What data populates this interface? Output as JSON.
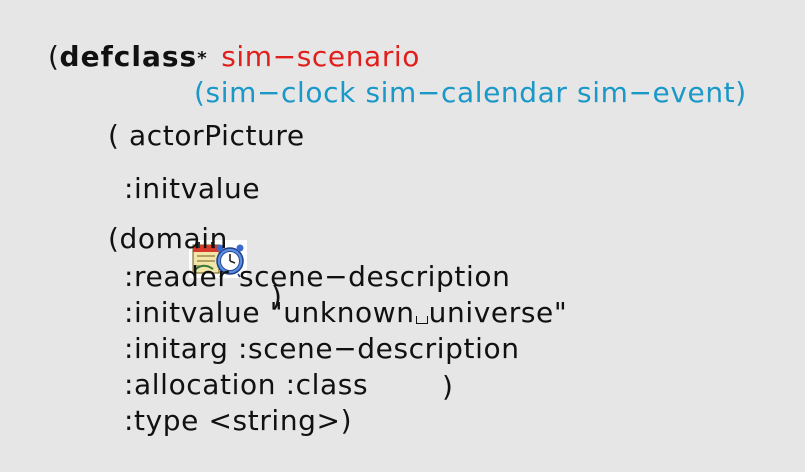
{
  "code": {
    "line1": {
      "open": "(",
      "keyword": "defclass",
      "star": "*",
      "name": "sim−scenario"
    },
    "line2": {
      "supers": "(sim−clock sim−calendar sim−event)"
    },
    "line3": {
      "text": "( actorPicture"
    },
    "line4": {
      "key": ":initvalue",
      "close": ")",
      "icon": "calendar-clock-icon"
    },
    "line5": {
      "text": "(domain"
    },
    "line6": {
      "text": ":reader scene−description"
    },
    "line7": {
      "key": ":initvalue ",
      "str_a": "\"unknown",
      "str_b": "universe\""
    },
    "line8": {
      "text": ":initarg :scene−description"
    },
    "line9": {
      "text": ":allocation :class"
    },
    "line10": {
      "text": ":type <string>)",
      "close": ")"
    }
  },
  "colors": {
    "keyword_red": "#e0201d",
    "cyan": "#1a98c8",
    "background": "#e6e6e6"
  }
}
